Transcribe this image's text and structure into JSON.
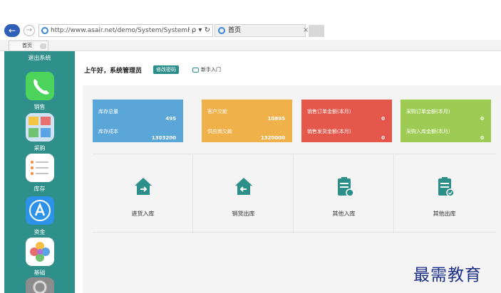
{
  "browser": {
    "address_url": "http://www.asair.net/demo/System/SystemFrame/",
    "address_controls": "ρ ▾ ↻",
    "tab_title": "首页",
    "tab_close": "×"
  },
  "inner_tabs": [
    {
      "label": "首页"
    }
  ],
  "sidebar": {
    "exit_label": "退出系统",
    "items": [
      {
        "label": "销售",
        "icon": "phone-icon"
      },
      {
        "label": "采购",
        "icon": "photos-icon"
      },
      {
        "label": "库存",
        "icon": "notes-icon"
      },
      {
        "label": "资金",
        "icon": "app-store-icon"
      },
      {
        "label": "基础",
        "icon": "flower-icon"
      }
    ]
  },
  "header": {
    "greeting": "上午好，系统管理员",
    "change_password": "修改密码",
    "guide": "新手入门"
  },
  "stats": [
    {
      "label1": "库存总量",
      "value1": "495",
      "label2": "库存成本",
      "value2": "1303200",
      "color": "#5ba6d9"
    },
    {
      "label1": "客户欠款",
      "value1": "10895",
      "label2": "供应商欠款",
      "value2": "1320000",
      "color": "#f0b04a"
    },
    {
      "label1": "销售订单金额(本月)",
      "value1": "0",
      "label2": "销售发货金额(本月)",
      "value2": "0",
      "color": "#e5574a"
    },
    {
      "label1": "采购订单金额(本月)",
      "value1": "0",
      "label2": "采购入库金额(本月)",
      "value2": "0",
      "color": "#9ecb53"
    }
  ],
  "actions": [
    {
      "label": "进货入库",
      "icon": "house-in-icon"
    },
    {
      "label": "销货出库",
      "icon": "house-out-icon"
    },
    {
      "label": "其他入库",
      "icon": "clipboard-in-icon"
    },
    {
      "label": "其他出库",
      "icon": "clipboard-out-icon"
    }
  ],
  "watermark": "最需教育"
}
